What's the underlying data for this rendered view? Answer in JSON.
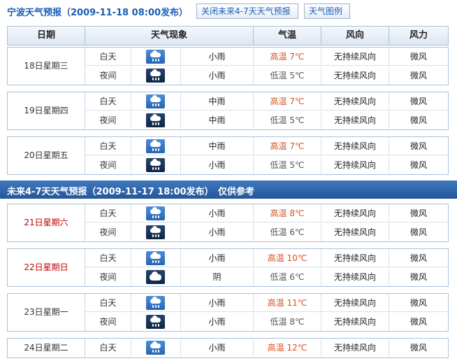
{
  "top": {
    "title": "宁波天气预报（2009-11-18 08:00发布）",
    "close_button": "关闭未来4-7天天气预报",
    "legend_button": "天气图例"
  },
  "header": {
    "date": "日期",
    "phenomenon": "天气现象",
    "temperature": "气温",
    "wind_direction": "风向",
    "wind_force": "风力"
  },
  "section2": {
    "title": "未来4-7天天气预报（2009-11-17 18:00发布）　仅供参考"
  },
  "colors": {
    "accent": "#1a5fb4",
    "weekend": "#c00000",
    "high_temp": "#d4521f"
  },
  "days": [
    {
      "date": "18日星期三",
      "weekend": false,
      "rows": [
        {
          "period": "白天",
          "icon": "rain-day-icon",
          "desc": "小雨",
          "temp_label": "高温",
          "temp": "7℃",
          "wind": "无持续风向",
          "force": "微风"
        },
        {
          "period": "夜间",
          "icon": "rain-night-icon",
          "desc": "小雨",
          "temp_label": "低温",
          "temp": "5℃",
          "wind": "无持续风向",
          "force": "微风"
        }
      ]
    },
    {
      "date": "19日星期四",
      "weekend": false,
      "rows": [
        {
          "period": "白天",
          "icon": "rain-day-icon",
          "desc": "中雨",
          "temp_label": "高温",
          "temp": "7℃",
          "wind": "无持续风向",
          "force": "微风"
        },
        {
          "period": "夜间",
          "icon": "rain-night-icon",
          "desc": "中雨",
          "temp_label": "低温",
          "temp": "5℃",
          "wind": "无持续风向",
          "force": "微风"
        }
      ]
    },
    {
      "date": "20日星期五",
      "weekend": false,
      "rows": [
        {
          "period": "白天",
          "icon": "rain-day-icon",
          "desc": "中雨",
          "temp_label": "高温",
          "temp": "7℃",
          "wind": "无持续风向",
          "force": "微风"
        },
        {
          "period": "夜间",
          "icon": "rain-night-icon",
          "desc": "小雨",
          "temp_label": "低温",
          "temp": "5℃",
          "wind": "无持续风向",
          "force": "微风"
        }
      ]
    },
    {
      "date": "21日星期六",
      "weekend": true,
      "rows": [
        {
          "period": "白天",
          "icon": "rain-day-icon",
          "desc": "小雨",
          "temp_label": "高温",
          "temp": "8℃",
          "wind": "无持续风向",
          "force": "微风"
        },
        {
          "period": "夜间",
          "icon": "rain-night-icon",
          "desc": "小雨",
          "temp_label": "低温",
          "temp": "6℃",
          "wind": "无持续风向",
          "force": "微风"
        }
      ]
    },
    {
      "date": "22日星期日",
      "weekend": true,
      "rows": [
        {
          "period": "白天",
          "icon": "rain-day-icon",
          "desc": "小雨",
          "temp_label": "高温",
          "temp": "10℃",
          "wind": "无持续风向",
          "force": "微风"
        },
        {
          "period": "夜间",
          "icon": "overcast-night-icon",
          "desc": "阴",
          "temp_label": "低温",
          "temp": "6℃",
          "wind": "无持续风向",
          "force": "微风"
        }
      ]
    },
    {
      "date": "23日星期一",
      "weekend": false,
      "rows": [
        {
          "period": "白天",
          "icon": "rain-day-icon",
          "desc": "小雨",
          "temp_label": "高温",
          "temp": "11℃",
          "wind": "无持续风向",
          "force": "微风"
        },
        {
          "period": "夜间",
          "icon": "rain-night-icon",
          "desc": "小雨",
          "temp_label": "低温",
          "temp": "8℃",
          "wind": "无持续风向",
          "force": "微风"
        }
      ]
    },
    {
      "date": "24日星期二",
      "weekend": false,
      "rows": [
        {
          "period": "白天",
          "icon": "rain-day-icon",
          "desc": "小雨",
          "temp_label": "高温",
          "temp": "12℃",
          "wind": "无持续风向",
          "force": "微风"
        }
      ]
    }
  ]
}
